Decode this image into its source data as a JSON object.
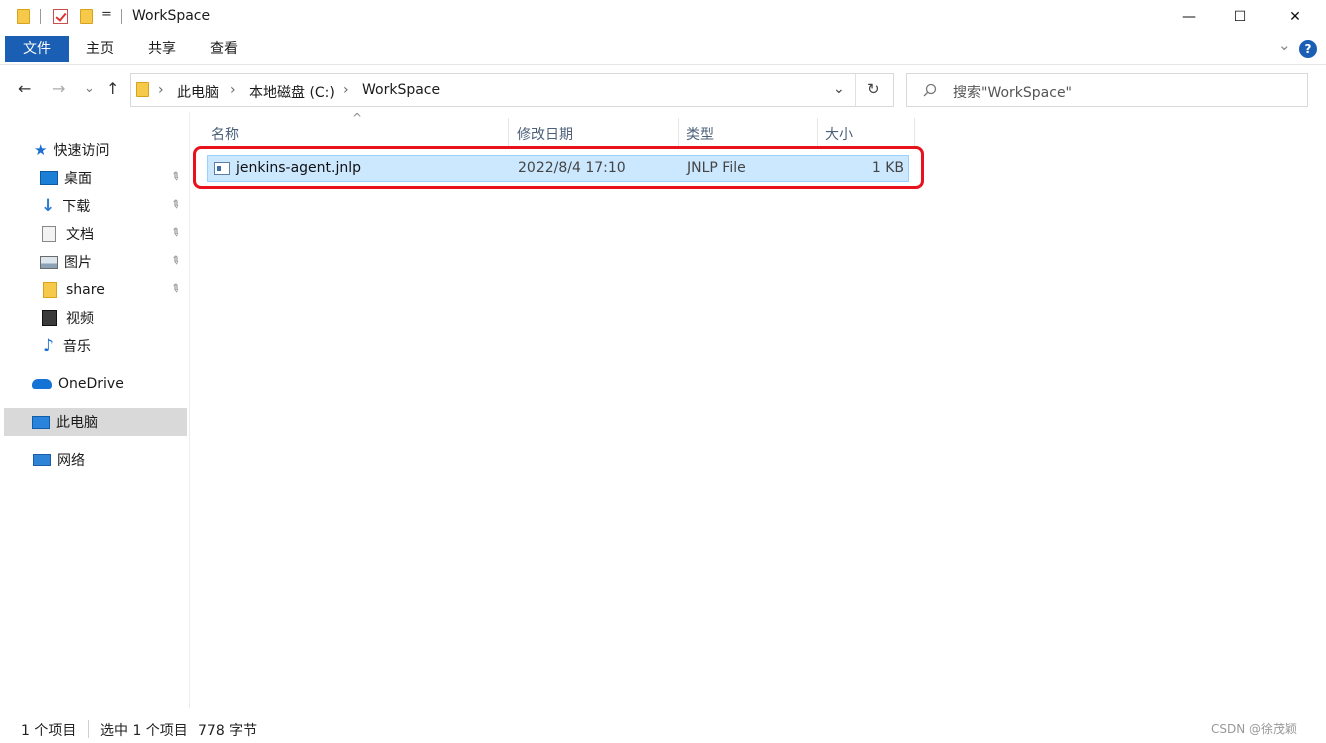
{
  "window": {
    "title": "WorkSpace",
    "controls": {
      "minimize": "—",
      "maximize": "☐",
      "close": "✕"
    }
  },
  "quick_access_toolbar": {
    "dropdown_glyph": "="
  },
  "ribbon": {
    "tabs": [
      "文件",
      "主页",
      "共享",
      "查看"
    ],
    "expand_glyph": "⌄",
    "help_glyph": "?",
    "accent_color": "#1a5fb4"
  },
  "navigation": {
    "back": "←",
    "forward": "→",
    "recent": "⌄",
    "up": "↑",
    "breadcrumb": [
      "此电脑",
      "本地磁盘 (C:)",
      "WorkSpace"
    ],
    "separator": "›",
    "dropdown": "⌄",
    "refresh": "↻"
  },
  "search": {
    "placeholder": "搜索\"WorkSpace\"",
    "icon": "search-icon"
  },
  "sidebar": {
    "quick_access_label": "快速访问",
    "items": [
      {
        "label": "桌面",
        "icon": "desktop-icon",
        "pinned": true
      },
      {
        "label": "下载",
        "icon": "download-icon",
        "pinned": true
      },
      {
        "label": "文档",
        "icon": "document-icon",
        "pinned": true
      },
      {
        "label": "图片",
        "icon": "picture-icon",
        "pinned": true
      },
      {
        "label": "share",
        "icon": "folder-icon",
        "pinned": true
      },
      {
        "label": "视频",
        "icon": "video-icon",
        "pinned": false
      },
      {
        "label": "音乐",
        "icon": "music-icon",
        "pinned": false
      }
    ],
    "onedrive_label": "OneDrive",
    "this_pc_label": "此电脑",
    "network_label": "网络"
  },
  "file_list": {
    "sort_glyph": "^",
    "columns": [
      "名称",
      "修改日期",
      "类型",
      "大小"
    ],
    "rows": [
      {
        "name": "jenkins-agent.jnlp",
        "modified": "2022/8/4 17:10",
        "type": "JNLP File",
        "size": "1 KB",
        "selected": true
      }
    ],
    "highlight_color": "#e8121d"
  },
  "status_bar": {
    "item_count": "1 个项目",
    "selected": "选中 1 个项目",
    "size": "778 字节"
  },
  "watermark": "CSDN @徐茂颖"
}
